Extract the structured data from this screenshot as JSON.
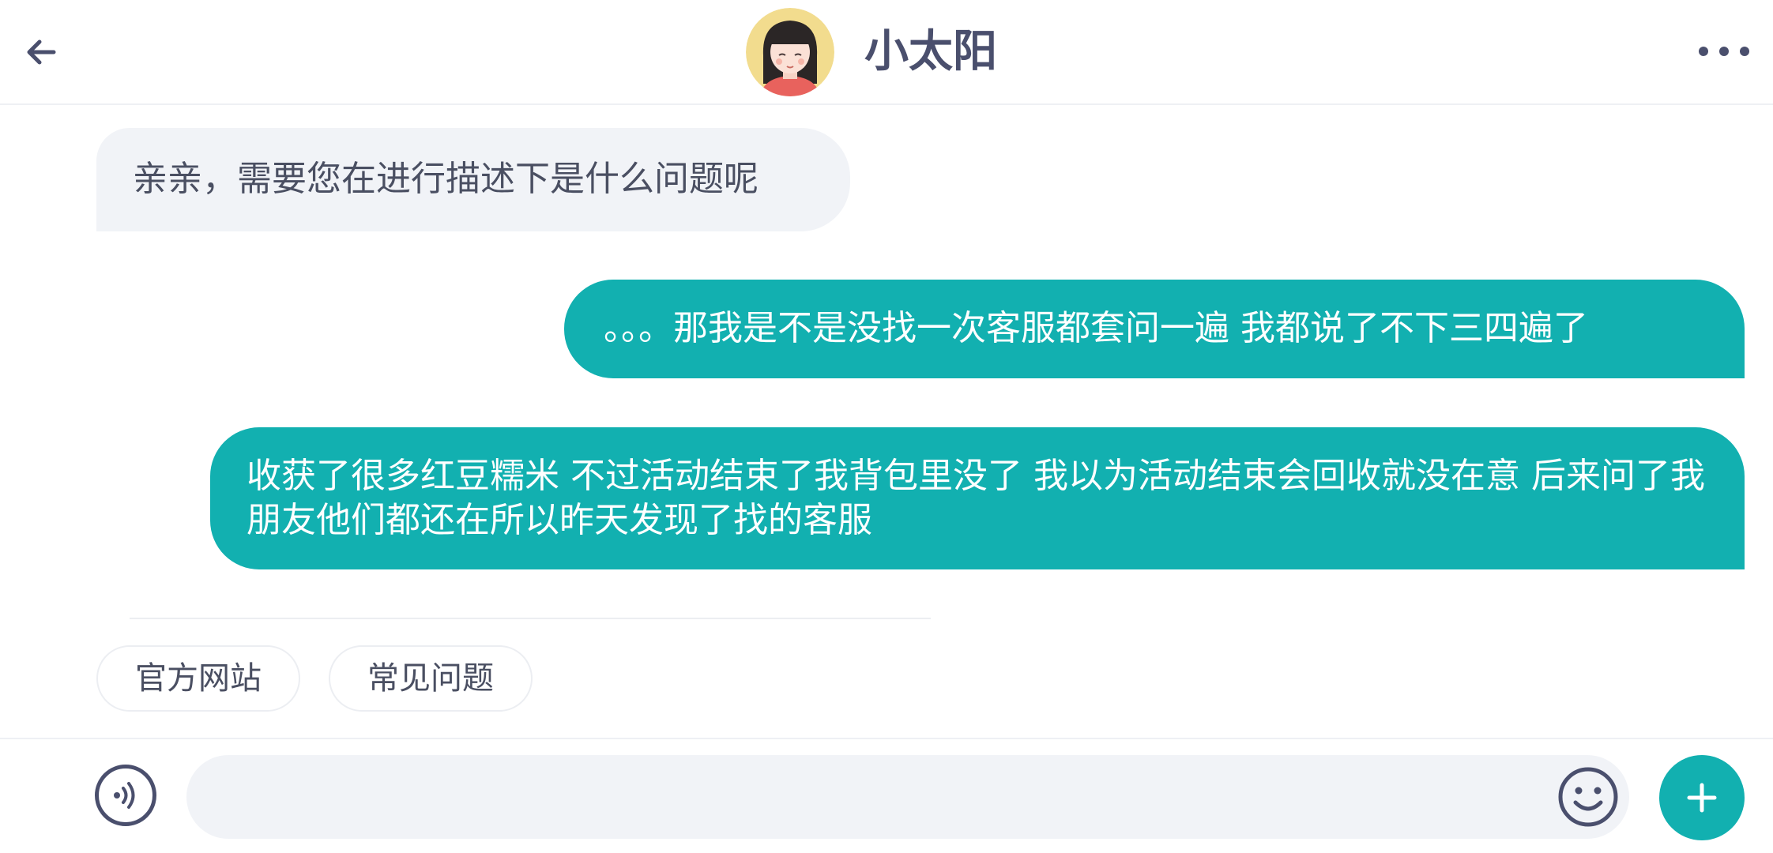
{
  "header": {
    "title": "小太阳",
    "back_icon": "arrow-left-icon",
    "more_icon": "more-horizontal-icon"
  },
  "messages": [
    {
      "direction": "incoming",
      "text": "亲亲，需要您在进行描述下是什么问题呢"
    },
    {
      "direction": "outgoing",
      "text": "。。。那我是不是没找一次客服都套问一遍 我都说了不下三四遍了"
    },
    {
      "direction": "outgoing",
      "text": "收获了很多红豆糯米 不过活动结束了我背包里没了 我以为活动结束会回收就没在意 后来问了我朋友他们都还在所以昨天发现了找的客服"
    }
  ],
  "quick_replies": [
    "官方网站",
    "常见问题"
  ],
  "input": {
    "placeholder": "",
    "value": ""
  },
  "colors": {
    "accent": "#12b0b0",
    "incoming_bubble": "#f1f3f7",
    "title_text": "#4a4f6d"
  }
}
